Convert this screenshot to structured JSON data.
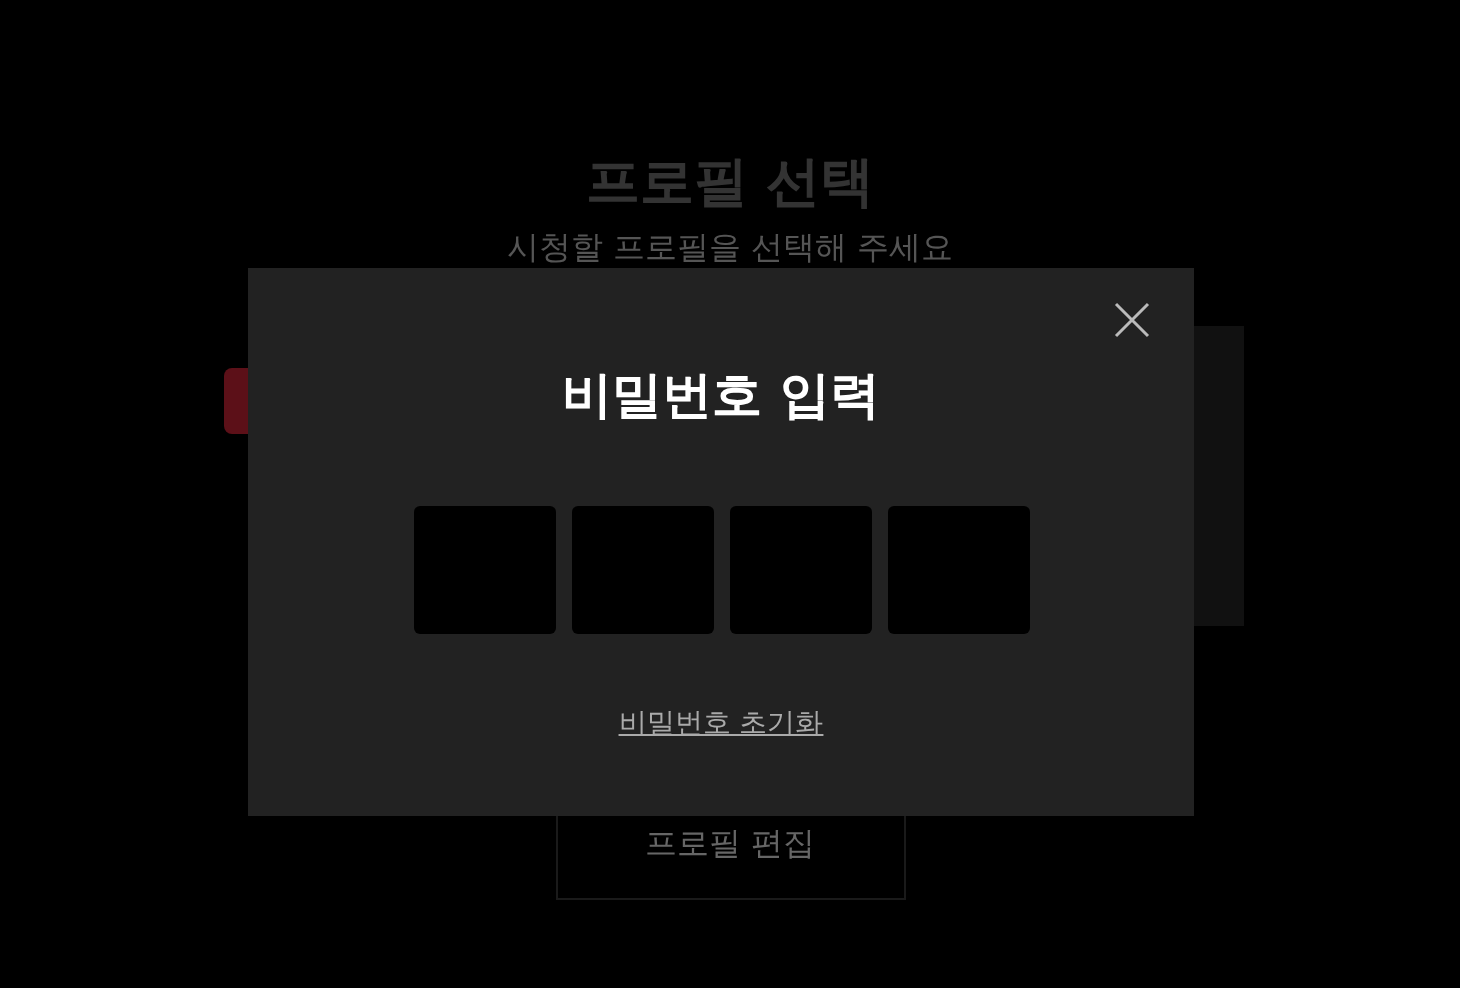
{
  "background": {
    "title": "프로필 선택",
    "subtitle": "시청할 프로필을 선택해 주세요",
    "profiles": [
      {
        "color": "#5c1018"
      },
      {
        "color": "#111111"
      }
    ],
    "edit_button": "프로필 편집"
  },
  "dialog": {
    "title": "비밀번호 입력",
    "pin_fields": [
      {
        "filled": false
      },
      {
        "filled": false
      },
      {
        "filled": false
      },
      {
        "filled": false
      }
    ],
    "reset_link": "비밀번호 초기화"
  }
}
